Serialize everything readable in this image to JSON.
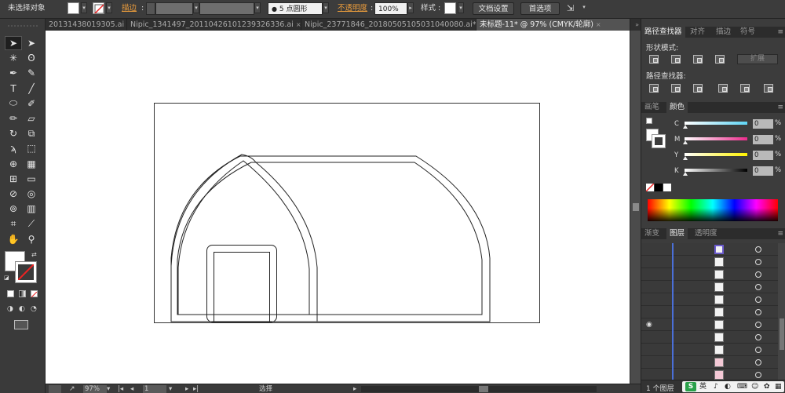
{
  "control_bar": {
    "selection_status": "未选择对象",
    "stroke_label": "描边",
    "brush_label": "5 点圆形",
    "opacity_label": "不透明度",
    "opacity_value": "100%",
    "style_label": "样式",
    "doc_setup_button": "文档设置",
    "preferences_button": "首选项"
  },
  "document_tabs": [
    {
      "label": "20131438019305.ai",
      "active": false
    },
    {
      "label": "Nipic_1341497_20110426101239326336.ai",
      "active": false
    },
    {
      "label": "Nipic_23771846_20180505105031040080.ai*",
      "active": false
    },
    {
      "label": "未标题-11* @ 97% (CMYK/轮廓)",
      "active": true
    }
  ],
  "tab_close_glyph": "×",
  "tab_overflow_glyph": "»",
  "toolbox": {
    "tools": [
      {
        "name": "selection-tool-icon",
        "glyph": "➤",
        "selected": true
      },
      {
        "name": "direct-selection-tool-icon",
        "glyph": "➤",
        "selected": false
      },
      {
        "name": "magic-wand-tool-icon",
        "glyph": "✳",
        "selected": false
      },
      {
        "name": "lasso-tool-icon",
        "glyph": "ʘ",
        "selected": false
      },
      {
        "name": "pen-tool-icon",
        "glyph": "✒",
        "selected": false
      },
      {
        "name": "curvature-tool-icon",
        "glyph": "✎",
        "selected": false
      },
      {
        "name": "type-tool-icon",
        "glyph": "T",
        "selected": false
      },
      {
        "name": "line-tool-icon",
        "glyph": "╱",
        "selected": false
      },
      {
        "name": "ellipse-tool-icon",
        "glyph": "⬭",
        "selected": false
      },
      {
        "name": "paintbrush-tool-icon",
        "glyph": "✐",
        "selected": false
      },
      {
        "name": "pencil-tool-icon",
        "glyph": "✏",
        "selected": false
      },
      {
        "name": "eraser-tool-icon",
        "glyph": "▱",
        "selected": false
      },
      {
        "name": "rotate-tool-icon",
        "glyph": "↻",
        "selected": false
      },
      {
        "name": "scale-tool-icon",
        "glyph": "⧉",
        "selected": false
      },
      {
        "name": "warp-tool-icon",
        "glyph": "ϡ",
        "selected": false
      },
      {
        "name": "free-transform-tool-icon",
        "glyph": "⬚",
        "selected": false
      },
      {
        "name": "shape-builder-tool-icon",
        "glyph": "⊕",
        "selected": false
      },
      {
        "name": "perspective-grid-tool-icon",
        "glyph": "▦",
        "selected": false
      },
      {
        "name": "mesh-tool-icon",
        "glyph": "⊞",
        "selected": false
      },
      {
        "name": "gradient-tool-icon",
        "glyph": "▭",
        "selected": false
      },
      {
        "name": "eyedropper-tool-icon",
        "glyph": "⊘",
        "selected": false
      },
      {
        "name": "blend-tool-icon",
        "glyph": "◎",
        "selected": false
      },
      {
        "name": "symbol-sprayer-tool-icon",
        "glyph": "⊚",
        "selected": false
      },
      {
        "name": "column-graph-tool-icon",
        "glyph": "▥",
        "selected": false
      },
      {
        "name": "artboard-tool-icon",
        "glyph": "⌗",
        "selected": false
      },
      {
        "name": "slice-tool-icon",
        "glyph": "⟋",
        "selected": false
      },
      {
        "name": "hand-tool-icon",
        "glyph": "✋",
        "selected": false
      },
      {
        "name": "zoom-tool-icon",
        "glyph": "⚲",
        "selected": false
      }
    ]
  },
  "status_bar": {
    "zoom": "97%",
    "artboard_number": "1",
    "tool_status": "选择"
  },
  "pathfinder_panel": {
    "tabs": [
      "路径查找器",
      "对齐",
      "描边",
      "符号"
    ],
    "shape_modes_label": "形状模式",
    "expand_button": "扩展",
    "pathfinders_label": "路径查找器"
  },
  "color_panel": {
    "tabs": [
      "画笔",
      "颜色"
    ],
    "channels": [
      {
        "label": "C",
        "value": "0",
        "gradient": "#5fd5f5"
      },
      {
        "label": "M",
        "value": "0",
        "gradient": "#ec2b8c"
      },
      {
        "label": "Y",
        "value": "0",
        "gradient": "#fff200"
      },
      {
        "label": "K",
        "value": "0",
        "gradient": "#000000"
      }
    ],
    "percent_sign": "%"
  },
  "layers_panel": {
    "tabs": [
      "渐变",
      "图层",
      "透明度"
    ],
    "layer_count": "1 个图层",
    "row_count": 11
  },
  "taskbar": {
    "ime_language": "英"
  }
}
